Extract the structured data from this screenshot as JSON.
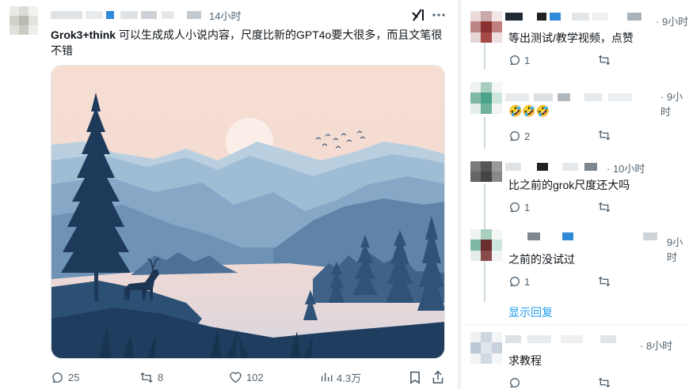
{
  "tweet": {
    "time": "14小时",
    "handle_bold": "Grok3+think",
    "text": " 可以生成成人小说内容，尺度比新的GPT4o要大很多，而且文笔很不错",
    "grok_icon": "grok-slash-icon",
    "more_icon": "more-dots-icon"
  },
  "actions": {
    "replies": "25",
    "retweets": "8",
    "likes": "102",
    "views": "4.3万"
  },
  "replies": [
    {
      "time": "· 9小时",
      "text": "等出测试/教学视频，点赞",
      "reply_count": "1"
    },
    {
      "time": "· 9小时",
      "text": "🤣🤣🤣",
      "reply_count": "2"
    },
    {
      "time": "· 10小时",
      "text": "比之前的grok尺度还大吗",
      "reply_count": "1"
    },
    {
      "time": "9小时",
      "text": "之前的没试过",
      "reply_count": "1"
    },
    {
      "time": "· 8小时",
      "text": "求教程",
      "reply_count": ""
    }
  ],
  "show_replies": "显示回复",
  "colors": {
    "accent": "#1d9bf0",
    "muted": "#536471"
  }
}
